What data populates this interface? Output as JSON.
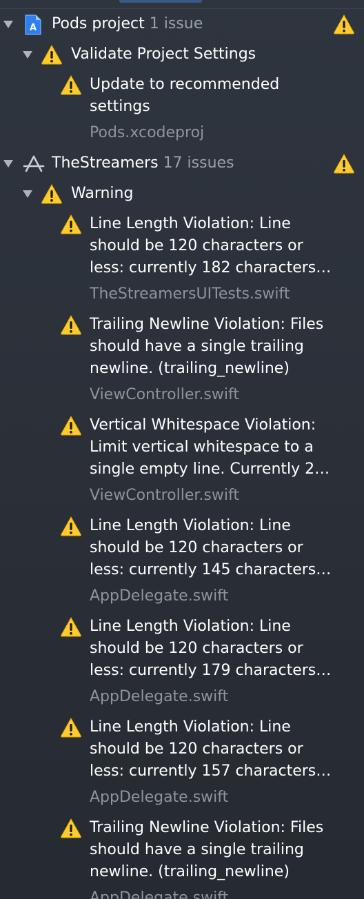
{
  "window": {
    "panel": "Issue Navigator"
  },
  "groups": [
    {
      "name": "Pods project",
      "count_text": "1 issue",
      "icon": "xcodeproj-file-icon",
      "categories": [
        {
          "name": "Validate Project Settings",
          "issues": [
            {
              "message": "Update to recommended\nsettings",
              "file": "Pods.xcodeproj"
            }
          ]
        }
      ]
    },
    {
      "name": "TheStreamers",
      "count_text": "17 issues",
      "icon": "app-target-icon",
      "categories": [
        {
          "name": "Warning",
          "issues": [
            {
              "message": "Line Length Violation: Line\nshould be 120 characters or\nless: currently 182 characters…",
              "file": "TheStreamersUITests.swift"
            },
            {
              "message": "Trailing Newline Violation: Files\nshould have a single trailing\nnewline. (trailing_newline)",
              "file": "ViewController.swift"
            },
            {
              "message": "Vertical Whitespace Violation:\nLimit vertical whitespace to a\nsingle empty line. Currently 2…",
              "file": "ViewController.swift"
            },
            {
              "message": "Line Length Violation: Line\nshould be 120 characters or\nless: currently 145 characters…",
              "file": "AppDelegate.swift"
            },
            {
              "message": "Line Length Violation: Line\nshould be 120 characters or\nless: currently 179 characters…",
              "file": "AppDelegate.swift"
            },
            {
              "message": "Line Length Violation: Line\nshould be 120 characters or\nless: currently 157 characters…",
              "file": "AppDelegate.swift"
            },
            {
              "message": "Trailing Newline Violation: Files\nshould have a single trailing\nnewline. (trailing_newline)",
              "file": "AppDelegate.swift"
            }
          ]
        }
      ]
    }
  ],
  "colors": {
    "background": "#2b3039",
    "warning": "#ffcc2f",
    "secondary_text": "#8e949c"
  }
}
